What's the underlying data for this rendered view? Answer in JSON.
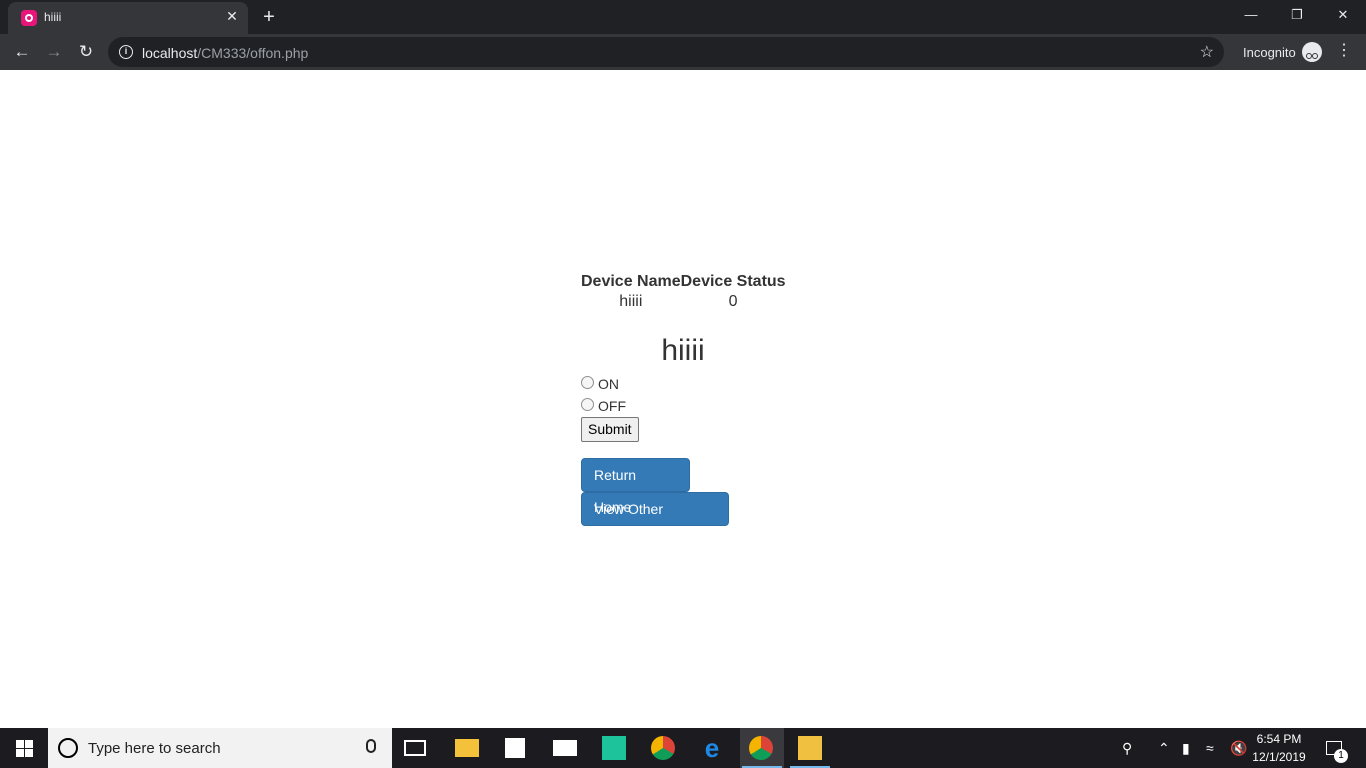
{
  "browser": {
    "tab_title": "hiiii",
    "tab_close": "✕",
    "new_tab": "+",
    "url_host": "localhost",
    "url_path": "/CM333/offon.php",
    "incognito_label": "Incognito",
    "minimize": "—",
    "restore": "❐",
    "close": "✕"
  },
  "page": {
    "table_headers": [
      "Device Name",
      "Device Status"
    ],
    "table_row": [
      "hiiii",
      "0"
    ],
    "device_title": "hiiii",
    "options": [
      "ON",
      "OFF"
    ],
    "submit_label": "Submit",
    "return_home_label": "Return Home",
    "view_devices_label": "View Other Devices"
  },
  "taskbar": {
    "search_placeholder": "Type here to search",
    "time": "6:54 PM",
    "date": "12/1/2019",
    "notification_count": "1"
  },
  "colors": {
    "primary_button": "#337ab7",
    "chrome_dark": "#202124",
    "chrome_toolbar": "#35363a",
    "favicon": "#e8157a"
  }
}
